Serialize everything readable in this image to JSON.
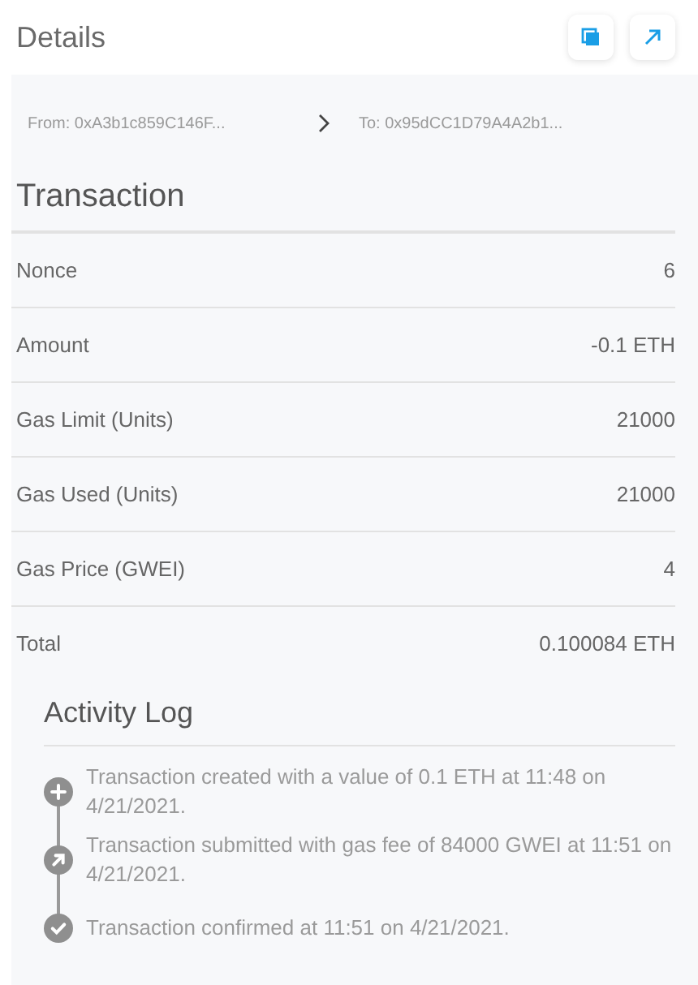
{
  "header": {
    "title": "Details"
  },
  "addresses": {
    "from": "From: 0xA3b1c859C146F...",
    "to": "To: 0x95dCC1D79A4A2b1..."
  },
  "transaction": {
    "title": "Transaction",
    "rows": [
      {
        "label": "Nonce",
        "value": "6"
      },
      {
        "label": "Amount",
        "value": "-0.1 ETH"
      },
      {
        "label": "Gas Limit (Units)",
        "value": "21000"
      },
      {
        "label": "Gas Used (Units)",
        "value": "21000"
      },
      {
        "label": "Gas Price (GWEI)",
        "value": "4"
      },
      {
        "label": "Total",
        "value": "0.100084 ETH"
      }
    ]
  },
  "activity_log": {
    "title": "Activity Log",
    "entries": [
      {
        "kind": "created",
        "text": "Transaction created with a value of 0.1 ETH at 11:48 on 4/21/2021."
      },
      {
        "kind": "submitted",
        "text": "Transaction submitted with gas fee of 84000 GWEI at 11:51 on 4/21/2021."
      },
      {
        "kind": "confirmed",
        "text": "Transaction confirmed at 11:51 on 4/21/2021."
      }
    ]
  }
}
